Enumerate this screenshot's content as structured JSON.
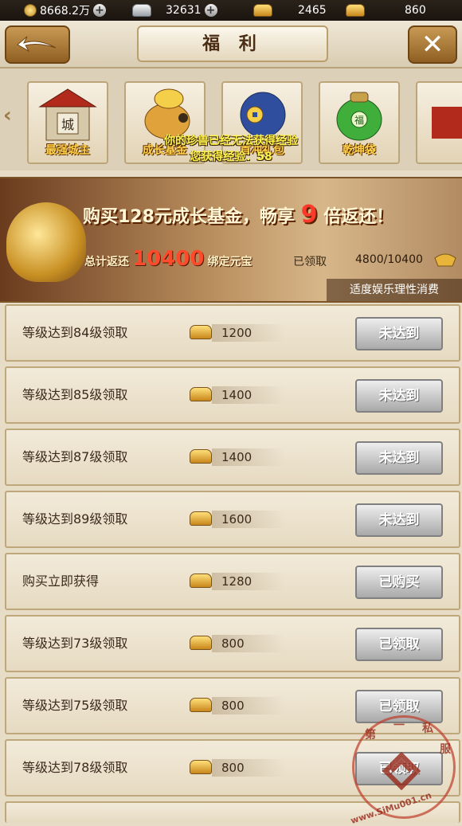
{
  "topbar": {
    "copper": "8668.2万",
    "silver": "32631",
    "gold": "2465",
    "bound_gold": "860"
  },
  "header": {
    "title": "福 利"
  },
  "icons": [
    {
      "label": "最强城主"
    },
    {
      "label": "成长基金"
    },
    {
      "label": "首冲礼包"
    },
    {
      "label": "乾坤袋"
    }
  ],
  "tips": {
    "line1": "你的珍兽已经无法获得经验",
    "line2": "您获得经验：58"
  },
  "banner": {
    "headline_pre": "购买128元成长基金，畅享",
    "headline_num": "9",
    "headline_post": "倍返还！",
    "total_pre": "总计返还",
    "total_num": "10400",
    "total_post": "绑定元宝",
    "claimed_label": "已领取",
    "progress": "4800/10400",
    "footer": "适度娱乐理性消费"
  },
  "rewards": [
    {
      "condition": "等级达到84级领取",
      "amount": "1200",
      "status": "未达到"
    },
    {
      "condition": "等级达到85级领取",
      "amount": "1400",
      "status": "未达到"
    },
    {
      "condition": "等级达到87级领取",
      "amount": "1400",
      "status": "未达到"
    },
    {
      "condition": "等级达到89级领取",
      "amount": "1600",
      "status": "未达到"
    },
    {
      "condition": "购买立即获得",
      "amount": "1280",
      "status": "已购买"
    },
    {
      "condition": "等级达到73级领取",
      "amount": "800",
      "status": "已领取"
    },
    {
      "condition": "等级达到75级领取",
      "amount": "800",
      "status": "已领取"
    },
    {
      "condition": "等级达到78级领取",
      "amount": "800",
      "status": "已领取"
    }
  ],
  "watermark": {
    "chars": [
      "第",
      "一",
      "私",
      "服"
    ],
    "url": "www.SiMu001.cn"
  },
  "colors": {
    "accent_gold": "#c8871c",
    "highlight_red": "#ff3a2b",
    "tip_yellow": "#fff34d"
  }
}
